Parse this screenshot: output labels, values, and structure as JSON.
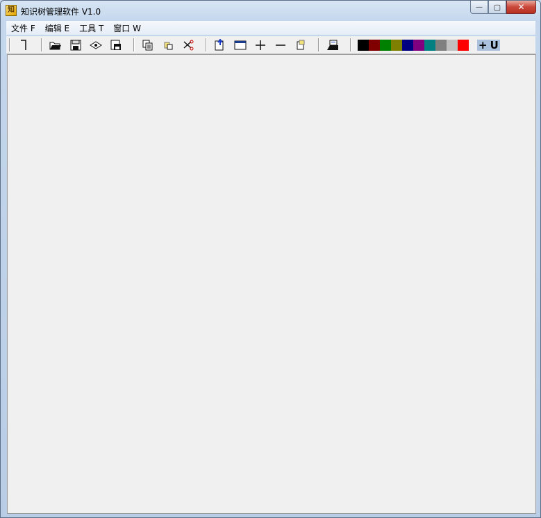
{
  "window": {
    "title": "知识树管理软件 V1.0",
    "icon_label": "知",
    "controls": {
      "minimize": "—",
      "maximize": "▢",
      "close": "✕"
    }
  },
  "menu": [
    {
      "label": "文件 F"
    },
    {
      "label": "编辑 E"
    },
    {
      "label": "工具 T"
    },
    {
      "label": "窗口 W"
    }
  ],
  "toolbar": {
    "swatch_colors": [
      "#000000",
      "#800000",
      "#008000",
      "#808000",
      "#000080",
      "#800080",
      "#008080",
      "#808080",
      "#c0c0c0",
      "#ff0000"
    ],
    "font_buttons": {
      "plus": "+",
      "underline": "U"
    },
    "accent": "#a9c1dc"
  }
}
